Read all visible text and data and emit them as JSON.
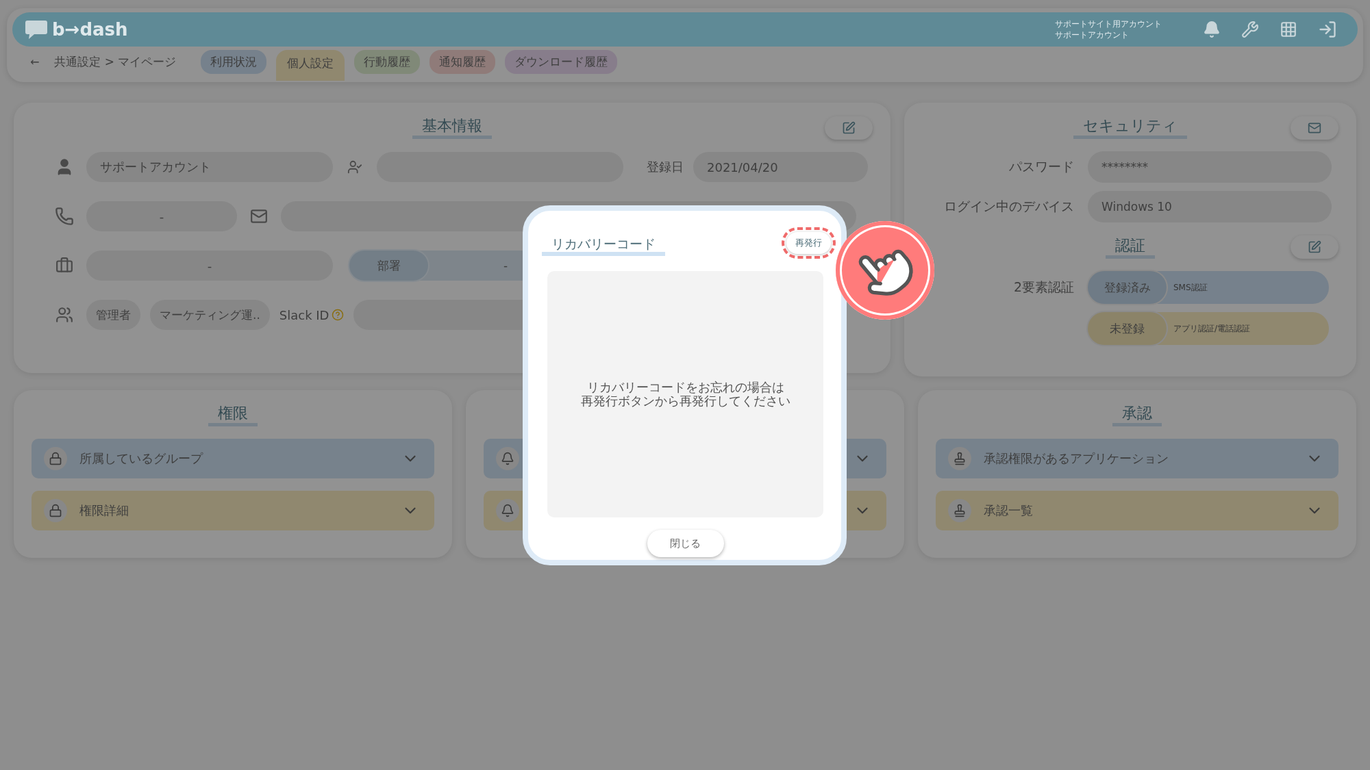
{
  "header": {
    "logo": "b→dash",
    "account_lines": [
      "サポートサイト用アカウント",
      "サポートアカウント"
    ]
  },
  "breadcrumb": {
    "back": "←",
    "path": "共通設定 > マイページ"
  },
  "tabs": [
    {
      "label": "利用状況",
      "selected": false,
      "color": "#76818c"
    },
    {
      "label": "個人設定",
      "selected": true,
      "color": "#90886f"
    },
    {
      "label": "行動履歴",
      "selected": false,
      "color": "#808978"
    },
    {
      "label": "通知履歴",
      "selected": false,
      "color": "#8f7b79"
    },
    {
      "label": "ダウンロード履歴",
      "selected": false,
      "color": "#877d8b"
    }
  ],
  "basic_info": {
    "title": "基本情報",
    "name": "サポートアカウント",
    "registered_label": "登録日",
    "registered_date": "2021/04/20",
    "phone": "-",
    "company": "-",
    "department_label": "部署",
    "department": "-",
    "role": "管理者",
    "team": "マーケティング運..",
    "slack_label": "Slack ID"
  },
  "security": {
    "title": "セキュリティ",
    "password_label": "パスワード",
    "password": "********",
    "device_label": "ログイン中のデバイス",
    "device": "Windows 10",
    "auth_title": "認証",
    "two_factor_label": "2要素認証",
    "methods": [
      {
        "status": "登録済み",
        "name": "SMS認証",
        "registered": true
      },
      {
        "status": "未登録",
        "name": "アプリ認証/電話認証",
        "registered": false
      }
    ]
  },
  "panels": [
    {
      "title": "権限",
      "kind": "lock",
      "rows": [
        {
          "label": "所属しているグループ",
          "color": "#77828c"
        },
        {
          "label": "権限詳細",
          "color": "#90886f"
        }
      ]
    },
    {
      "kind": "bell",
      "rows": [
        {
          "color": "#77828c"
        },
        {
          "color": "#90886f"
        }
      ]
    },
    {
      "title": "承認",
      "kind": "stamp",
      "rows": [
        {
          "label": "承認権限があるアプリケーション",
          "color": "#77828c"
        },
        {
          "label": "承認一覧",
          "color": "#90886f"
        }
      ]
    }
  ],
  "modal": {
    "title": "リカバリーコード",
    "reissue_button": "再発行",
    "reissue_highlighted": true,
    "message_lines": [
      "リカバリーコードをお忘れの場合は",
      "再発行ボタンから再発行してください"
    ],
    "close_button": "閉じる"
  }
}
